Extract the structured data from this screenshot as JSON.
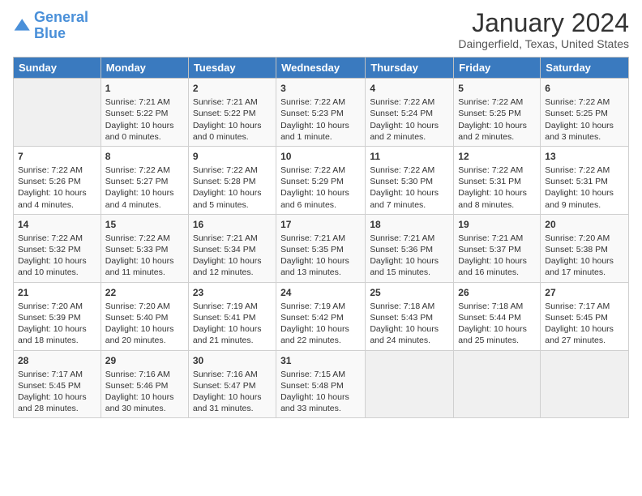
{
  "header": {
    "logo_line1": "General",
    "logo_line2": "Blue",
    "month": "January 2024",
    "location": "Daingerfield, Texas, United States"
  },
  "days_of_week": [
    "Sunday",
    "Monday",
    "Tuesday",
    "Wednesday",
    "Thursday",
    "Friday",
    "Saturday"
  ],
  "weeks": [
    [
      {
        "day": "",
        "content": ""
      },
      {
        "day": "1",
        "content": "Sunrise: 7:21 AM\nSunset: 5:22 PM\nDaylight: 10 hours\nand 0 minutes."
      },
      {
        "day": "2",
        "content": "Sunrise: 7:21 AM\nSunset: 5:22 PM\nDaylight: 10 hours\nand 0 minutes."
      },
      {
        "day": "3",
        "content": "Sunrise: 7:22 AM\nSunset: 5:23 PM\nDaylight: 10 hours\nand 1 minute."
      },
      {
        "day": "4",
        "content": "Sunrise: 7:22 AM\nSunset: 5:24 PM\nDaylight: 10 hours\nand 2 minutes."
      },
      {
        "day": "5",
        "content": "Sunrise: 7:22 AM\nSunset: 5:25 PM\nDaylight: 10 hours\nand 2 minutes."
      },
      {
        "day": "6",
        "content": "Sunrise: 7:22 AM\nSunset: 5:25 PM\nDaylight: 10 hours\nand 3 minutes."
      }
    ],
    [
      {
        "day": "7",
        "content": "Sunrise: 7:22 AM\nSunset: 5:26 PM\nDaylight: 10 hours\nand 4 minutes."
      },
      {
        "day": "8",
        "content": "Sunrise: 7:22 AM\nSunset: 5:27 PM\nDaylight: 10 hours\nand 4 minutes."
      },
      {
        "day": "9",
        "content": "Sunrise: 7:22 AM\nSunset: 5:28 PM\nDaylight: 10 hours\nand 5 minutes."
      },
      {
        "day": "10",
        "content": "Sunrise: 7:22 AM\nSunset: 5:29 PM\nDaylight: 10 hours\nand 6 minutes."
      },
      {
        "day": "11",
        "content": "Sunrise: 7:22 AM\nSunset: 5:30 PM\nDaylight: 10 hours\nand 7 minutes."
      },
      {
        "day": "12",
        "content": "Sunrise: 7:22 AM\nSunset: 5:31 PM\nDaylight: 10 hours\nand 8 minutes."
      },
      {
        "day": "13",
        "content": "Sunrise: 7:22 AM\nSunset: 5:31 PM\nDaylight: 10 hours\nand 9 minutes."
      }
    ],
    [
      {
        "day": "14",
        "content": "Sunrise: 7:22 AM\nSunset: 5:32 PM\nDaylight: 10 hours\nand 10 minutes."
      },
      {
        "day": "15",
        "content": "Sunrise: 7:22 AM\nSunset: 5:33 PM\nDaylight: 10 hours\nand 11 minutes."
      },
      {
        "day": "16",
        "content": "Sunrise: 7:21 AM\nSunset: 5:34 PM\nDaylight: 10 hours\nand 12 minutes."
      },
      {
        "day": "17",
        "content": "Sunrise: 7:21 AM\nSunset: 5:35 PM\nDaylight: 10 hours\nand 13 minutes."
      },
      {
        "day": "18",
        "content": "Sunrise: 7:21 AM\nSunset: 5:36 PM\nDaylight: 10 hours\nand 15 minutes."
      },
      {
        "day": "19",
        "content": "Sunrise: 7:21 AM\nSunset: 5:37 PM\nDaylight: 10 hours\nand 16 minutes."
      },
      {
        "day": "20",
        "content": "Sunrise: 7:20 AM\nSunset: 5:38 PM\nDaylight: 10 hours\nand 17 minutes."
      }
    ],
    [
      {
        "day": "21",
        "content": "Sunrise: 7:20 AM\nSunset: 5:39 PM\nDaylight: 10 hours\nand 18 minutes."
      },
      {
        "day": "22",
        "content": "Sunrise: 7:20 AM\nSunset: 5:40 PM\nDaylight: 10 hours\nand 20 minutes."
      },
      {
        "day": "23",
        "content": "Sunrise: 7:19 AM\nSunset: 5:41 PM\nDaylight: 10 hours\nand 21 minutes."
      },
      {
        "day": "24",
        "content": "Sunrise: 7:19 AM\nSunset: 5:42 PM\nDaylight: 10 hours\nand 22 minutes."
      },
      {
        "day": "25",
        "content": "Sunrise: 7:18 AM\nSunset: 5:43 PM\nDaylight: 10 hours\nand 24 minutes."
      },
      {
        "day": "26",
        "content": "Sunrise: 7:18 AM\nSunset: 5:44 PM\nDaylight: 10 hours\nand 25 minutes."
      },
      {
        "day": "27",
        "content": "Sunrise: 7:17 AM\nSunset: 5:45 PM\nDaylight: 10 hours\nand 27 minutes."
      }
    ],
    [
      {
        "day": "28",
        "content": "Sunrise: 7:17 AM\nSunset: 5:45 PM\nDaylight: 10 hours\nand 28 minutes."
      },
      {
        "day": "29",
        "content": "Sunrise: 7:16 AM\nSunset: 5:46 PM\nDaylight: 10 hours\nand 30 minutes."
      },
      {
        "day": "30",
        "content": "Sunrise: 7:16 AM\nSunset: 5:47 PM\nDaylight: 10 hours\nand 31 minutes."
      },
      {
        "day": "31",
        "content": "Sunrise: 7:15 AM\nSunset: 5:48 PM\nDaylight: 10 hours\nand 33 minutes."
      },
      {
        "day": "",
        "content": ""
      },
      {
        "day": "",
        "content": ""
      },
      {
        "day": "",
        "content": ""
      }
    ]
  ]
}
